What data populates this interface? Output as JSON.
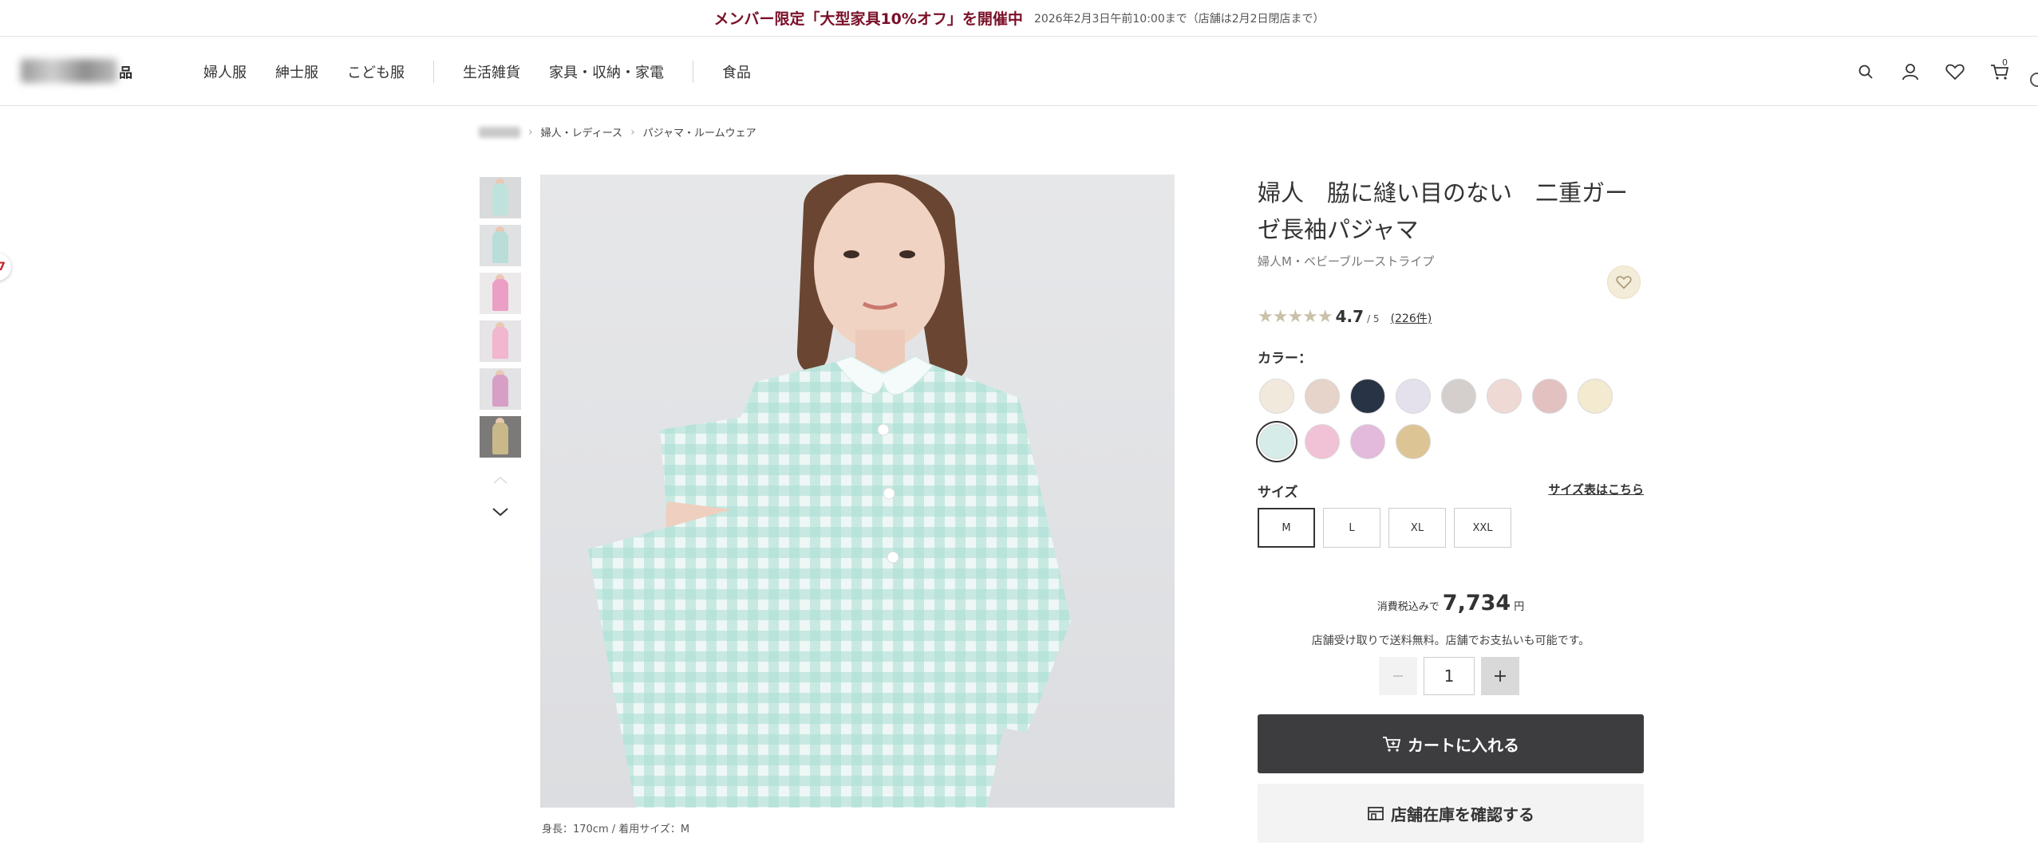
{
  "banner": {
    "headline": "メンバー限定「大型家具10%オフ」を開催中",
    "period": "2026年2月3日午前10:00まで（店舗は2月2日閉店まで）"
  },
  "header": {
    "logo_suffix": "品",
    "nav": [
      {
        "label": "婦人服"
      },
      {
        "label": "紳士服"
      },
      {
        "label": "こども服"
      },
      {
        "label": "生活雑貨"
      },
      {
        "label": "家具・収納・家電"
      },
      {
        "label": "食品"
      }
    ],
    "cart_count": "0",
    "icons": [
      "search-icon",
      "account-icon",
      "heart-icon",
      "cart-icon"
    ]
  },
  "edge_badge": "7",
  "breadcrumb": {
    "items": [
      {
        "label": "婦人・レディース"
      },
      {
        "label": "パジャマ・ルームウェア"
      }
    ]
  },
  "gallery": {
    "thumb_colors": [
      "#bfe3dc",
      "#b9ddd8",
      "#ec9fc4",
      "#f2b6cf",
      "#d79fc6",
      "#c9b98a"
    ],
    "caption": "身長：170cm / 着用サイズ：M"
  },
  "product": {
    "title": "婦人　脇に縫い目のない　二重ガーゼ長袖パジャマ",
    "subtitle": "婦人M・ベビーブルーストライプ",
    "rating": {
      "stars": "★★★★★",
      "value": "4.7",
      "max": "/ 5",
      "count": "(226件)"
    },
    "color_label": "カラー：",
    "colors": [
      {
        "name": "ivory",
        "fill": "#f1e9dc"
      },
      {
        "name": "beige",
        "fill": "#e6d3c9"
      },
      {
        "name": "navy",
        "fill": "#283445"
      },
      {
        "name": "lavender",
        "fill": "#e4e0ec"
      },
      {
        "name": "gray-stripe",
        "fill": "#d4cfcc"
      },
      {
        "name": "pink-stripe",
        "fill": "#efd9d5"
      },
      {
        "name": "dusty-pink",
        "fill": "#e3c1c1"
      },
      {
        "name": "yellow-stripe",
        "fill": "#f3ead0"
      },
      {
        "name": "baby-blue-stripe",
        "fill": "#d6ece9",
        "selected": true
      },
      {
        "name": "pink-check",
        "fill": "#f1c2d6"
      },
      {
        "name": "purple-check",
        "fill": "#e3b9dc"
      },
      {
        "name": "mustard-check",
        "fill": "#ddc494"
      }
    ],
    "size_label": "サイズ",
    "size_chart_link": "サイズ表はこちら",
    "sizes": [
      {
        "label": "M",
        "selected": true
      },
      {
        "label": "L"
      },
      {
        "label": "XL"
      },
      {
        "label": "XXL"
      }
    ],
    "price": {
      "prefix": "消費税込みで",
      "value": "7,734",
      "unit": "円"
    },
    "shipping_note": "店舗受け取りで送料無料。店舗でお支払いも可能です。",
    "quantity": "1",
    "cart_button": "カートに入れる",
    "stock_button": "店舗在庫を確認する"
  }
}
